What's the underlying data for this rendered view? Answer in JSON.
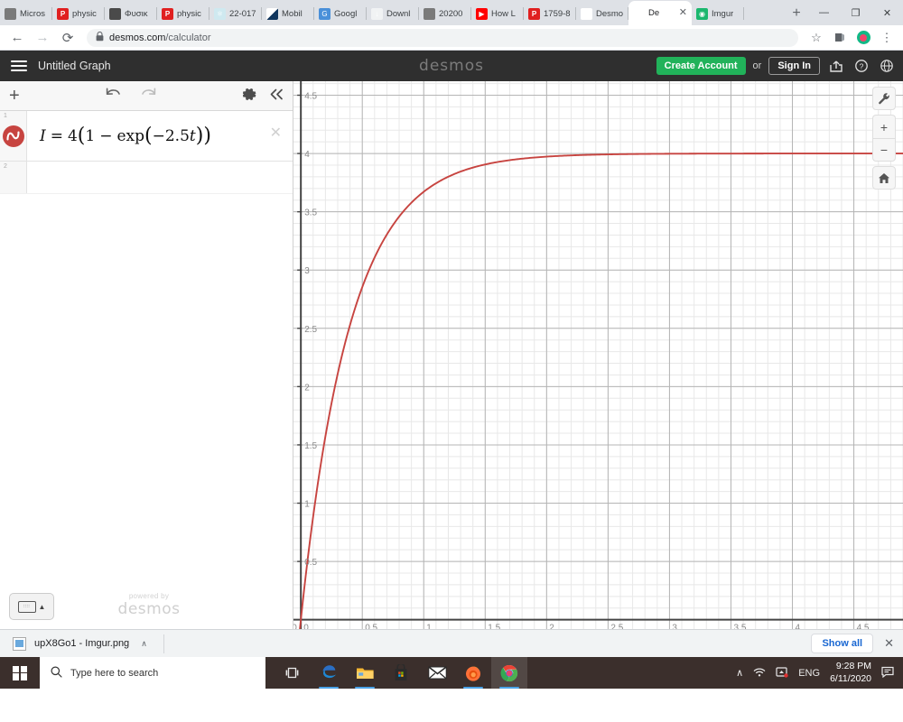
{
  "browser": {
    "tabs": [
      {
        "title": "Micros",
        "favicon": "globe-icon",
        "active": false
      },
      {
        "title": "physic",
        "favicon": "pdf-icon",
        "active": false
      },
      {
        "title": "Φυσικ",
        "favicon": "image-icon",
        "active": false
      },
      {
        "title": "physic",
        "favicon": "pdf-icon",
        "active": false
      },
      {
        "title": "22-017",
        "favicon": "atom-icon",
        "active": false
      },
      {
        "title": "Mobil",
        "favicon": "dark-triangle-icon",
        "active": false
      },
      {
        "title": "Googl",
        "favicon": "google-docs-icon",
        "active": false
      },
      {
        "title": "Downl",
        "favicon": "download-icon",
        "active": false
      },
      {
        "title": "20200",
        "favicon": "globe-icon",
        "active": false
      },
      {
        "title": "How L",
        "favicon": "youtube-icon",
        "active": false
      },
      {
        "title": "1759-8",
        "favicon": "pdf-icon",
        "active": false
      },
      {
        "title": "Desmo",
        "favicon": "desmos-icon",
        "active": false
      },
      {
        "title": "De",
        "favicon": "desmos-icon",
        "active": true
      },
      {
        "title": "Imgur",
        "favicon": "imgur-icon",
        "active": false
      }
    ],
    "new_tab_label": "+",
    "window_controls": {
      "minimize": "—",
      "maximize": "❐",
      "close": "✕"
    },
    "toolbar": {
      "back": "←",
      "forward": "→",
      "reload": "⟳",
      "lock_icon": "🔒",
      "url_domain": "desmos.com",
      "url_path": "/calculator",
      "bookmark": "☆",
      "extensions": "⬛",
      "menu": "⋮"
    }
  },
  "desmos": {
    "header": {
      "menu_label": "menu",
      "graph_title": "Untitled Graph",
      "wordmark": "desmos",
      "create_account": "Create Account",
      "or": "or",
      "sign_in": "Sign In",
      "share_icon": "share-icon",
      "help_icon": "help-icon",
      "language_icon": "globe-icon"
    },
    "sidebar": {
      "add_label": "+",
      "undo_icon": "undo-arrow",
      "redo_icon": "redo-arrow",
      "settings_icon": "gear-icon",
      "collapse_icon": "double-chevron-left",
      "expressions": [
        {
          "index": "1",
          "latex_plain": "I = 4(1 - exp(-2.5t))",
          "color": "#c74440",
          "parts": {
            "lhs": "I",
            "eq": "=",
            "coeff": "4",
            "open1": "(",
            "one": "1",
            "minus": "−",
            "fn": "exp",
            "open2": "(",
            "neg": "−",
            "rate": "2.5",
            "var": "t",
            "close2": ")",
            "close1": ")"
          },
          "delete_label": "✕"
        },
        {
          "index": "2",
          "latex_plain": "",
          "color": "",
          "delete_label": ""
        }
      ],
      "keyboard_button": "keyboard-icon",
      "keyboard_caret": "▲",
      "powered_by_line1": "powered by",
      "powered_by_line2": "desmos"
    },
    "graph_controls": {
      "wrench": "wrench-icon",
      "zoom_in": "+",
      "zoom_out": "−",
      "home": "home-icon"
    }
  },
  "chart_data": {
    "type": "line",
    "title": "",
    "xlabel": "",
    "ylabel": "",
    "xlim": [
      -0.06,
      4.9
    ],
    "ylim": [
      -0.08,
      4.62
    ],
    "xticks": [
      0,
      0.5,
      1,
      1.5,
      2,
      2.5,
      3,
      3.5,
      4,
      4.5
    ],
    "xtick_labels": [
      "0",
      "0.5",
      "1",
      "1.5",
      "2",
      "2.5",
      "3",
      "3.5",
      "4",
      "4.5"
    ],
    "yticks": [
      0.5,
      1,
      1.5,
      2,
      2.5,
      3,
      3.5,
      4,
      4.5
    ],
    "ytick_labels": [
      "0.5",
      "1",
      "1.5",
      "2",
      "2.5",
      "3",
      "3.5",
      "4",
      "4.5"
    ],
    "grid": true,
    "minor_grid_step": 0.1,
    "major_grid_step": 0.5,
    "series": [
      {
        "name": "I = 4(1 - exp(-2.5t))",
        "color": "#c74440",
        "formula": {
          "amplitude": 4,
          "rate": 2.5
        },
        "x": [
          0,
          0.1,
          0.2,
          0.3,
          0.4,
          0.5,
          0.6,
          0.7,
          0.8,
          0.9,
          1.0,
          1.2,
          1.4,
          1.6,
          1.8,
          2.0,
          2.5,
          3.0,
          3.5,
          4.0,
          4.5,
          4.9
        ],
        "y": [
          0,
          0.885,
          1.575,
          2.112,
          2.529,
          2.854,
          3.107,
          3.303,
          3.457,
          3.578,
          3.672,
          3.801,
          3.879,
          3.927,
          3.956,
          3.973,
          3.993,
          3.998,
          3.999,
          4.0,
          4.0,
          4.0
        ]
      }
    ]
  },
  "downloads_bar": {
    "file_name": "upX8Go1 - Imgur.png",
    "file_caret": "∧",
    "show_all": "Show all",
    "close": "✕"
  },
  "taskbar": {
    "start_label": "windows-start",
    "search_placeholder": "Type here to search",
    "apps": [
      {
        "name": "task-view-icon"
      },
      {
        "name": "edge-icon"
      },
      {
        "name": "file-explorer-icon"
      },
      {
        "name": "microsoft-store-icon"
      },
      {
        "name": "mail-icon"
      },
      {
        "name": "firefox-icon"
      },
      {
        "name": "chrome-icon"
      }
    ],
    "tray": {
      "overflow": "∧",
      "network": "network-icon",
      "sound": "sound-icon",
      "language": "ENG",
      "time": "9:28 PM",
      "date": "6/11/2020",
      "action_center": "notification-icon"
    }
  },
  "colors": {
    "accent_green": "#21b25a",
    "curve_red": "#c74440",
    "header_dark": "#2f2f2f",
    "taskbar": "#3b2f2c"
  }
}
